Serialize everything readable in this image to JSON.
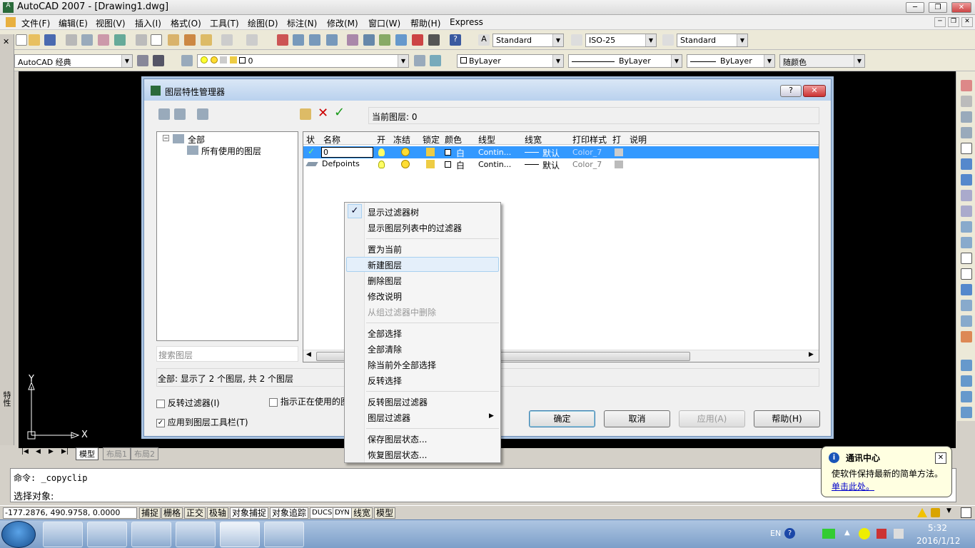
{
  "app": {
    "title": "AutoCAD 2007 - [Drawing1.dwg]",
    "colors": {
      "canvas": "#000000",
      "selection": "#3399ff",
      "dialog_bg": "#f0f0f0"
    }
  },
  "menus": [
    "文件(F)",
    "编辑(E)",
    "视图(V)",
    "插入(I)",
    "格式(O)",
    "工具(T)",
    "绘图(D)",
    "标注(N)",
    "修改(M)",
    "窗口(W)",
    "帮助(H)",
    "Express"
  ],
  "toolbar": {
    "text_style": "Standard",
    "dim_style": "ISO-25",
    "table_style": "Standard",
    "workspace": "AutoCAD 经典",
    "layer": "0",
    "color": "ByLayer",
    "linetype": "ByLayer",
    "lineweight": "ByLayer",
    "plotstyle": "随颜色"
  },
  "dialog": {
    "title": "图层特性管理器",
    "current_layer": "当前图层: 0",
    "tree": {
      "root": "全部",
      "child": "所有使用的图层"
    },
    "search_placeholder": "搜索图层",
    "columns": [
      "状",
      "名称",
      "开",
      "冻结",
      "锁定",
      "颜色",
      "线型",
      "线宽",
      "打印样式",
      "打",
      "说明"
    ],
    "layers": [
      {
        "name": "0",
        "color": "白",
        "linetype": "Contin...",
        "lineweight": "默认",
        "plotstyle": "Color_7"
      },
      {
        "name": "Defpoints",
        "color": "白",
        "linetype": "Contin...",
        "lineweight": "默认",
        "plotstyle": "Color_7"
      }
    ],
    "summary": "全部: 显示了 2 个图层, 共 2 个图层",
    "invert_filter": "反转过滤器(I)",
    "indicate_used": "指示正在使用的图",
    "apply_toolbar": "应用到图层工具栏(T)",
    "buttons": {
      "ok": "确定",
      "cancel": "取消",
      "apply": "应用(A)",
      "help": "帮助(H)"
    }
  },
  "context_menu": {
    "items": [
      {
        "label": "显示过滤器树",
        "checked": true
      },
      {
        "label": "显示图层列表中的过滤器"
      },
      {
        "label": "置为当前"
      },
      {
        "label": "新建图层",
        "highlight": true
      },
      {
        "label": "删除图层"
      },
      {
        "label": "修改说明"
      },
      {
        "label": "从组过滤器中删除",
        "disabled": true
      },
      {
        "label": "全部选择"
      },
      {
        "label": "全部清除"
      },
      {
        "label": "除当前外全部选择"
      },
      {
        "label": "反转选择"
      },
      {
        "label": "反转图层过滤器"
      },
      {
        "label": "图层过滤器",
        "submenu": true
      },
      {
        "label": "保存图层状态..."
      },
      {
        "label": "恢复图层状态..."
      }
    ]
  },
  "tabs": [
    "模型",
    "布局1",
    "布局2"
  ],
  "command": {
    "line1": "命令: _copyclip",
    "line2": "选择对象:"
  },
  "status": {
    "coords": "-177.2876, 490.9758, 0.0000",
    "toggles": [
      "捕捉",
      "栅格",
      "正交",
      "极轴",
      "对象捕捉",
      "对象追踪",
      "DUCS",
      "DYN",
      "线宽",
      "模型"
    ]
  },
  "balloon": {
    "title": "通讯中心",
    "text": "使软件保持最新的简单方法。",
    "link": "单击此处。"
  },
  "axes": {
    "x": "X",
    "y": "Y"
  },
  "palette_label": "特性",
  "taskbar": {
    "lang": "EN",
    "time": "5:32",
    "date": "2016/1/12"
  }
}
